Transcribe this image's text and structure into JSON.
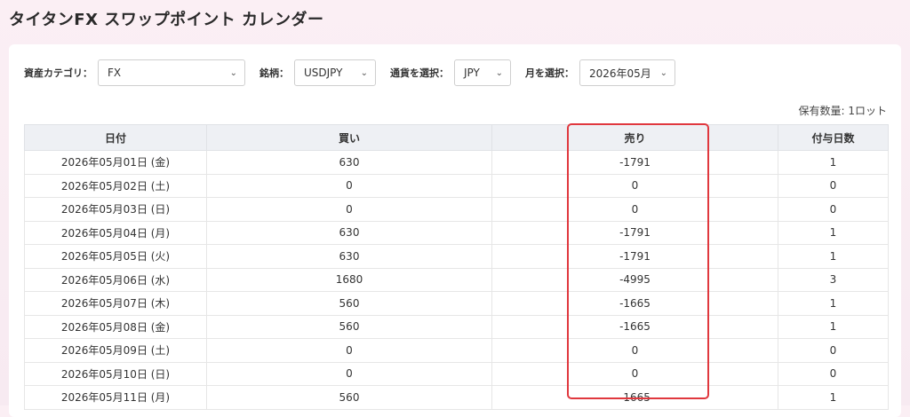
{
  "title": "タイタンFX スワップポイント カレンダー",
  "filters": {
    "asset_label": "資産カテゴリ：",
    "asset_value": "FX",
    "symbol_label": "銘柄：",
    "symbol_value": "USDJPY",
    "currency_label": "通貨を選択：",
    "currency_value": "JPY",
    "month_label": "月を選択：",
    "month_value": "2026年05月"
  },
  "holdings": "保有数量: 1ロット",
  "table": {
    "headers": [
      "日付",
      "買い",
      "売り",
      "付与日数"
    ],
    "rows": [
      [
        "2026年05月01日 (金)",
        "630",
        "-1791",
        "1"
      ],
      [
        "2026年05月02日 (土)",
        "0",
        "0",
        "0"
      ],
      [
        "2026年05月03日 (日)",
        "0",
        "0",
        "0"
      ],
      [
        "2026年05月04日 (月)",
        "630",
        "-1791",
        "1"
      ],
      [
        "2026年05月05日 (火)",
        "630",
        "-1791",
        "1"
      ],
      [
        "2026年05月06日 (水)",
        "1680",
        "-4995",
        "3"
      ],
      [
        "2026年05月07日 (木)",
        "560",
        "-1665",
        "1"
      ],
      [
        "2026年05月08日 (金)",
        "560",
        "-1665",
        "1"
      ],
      [
        "2026年05月09日 (土)",
        "0",
        "0",
        "0"
      ],
      [
        "2026年05月10日 (日)",
        "0",
        "0",
        "0"
      ],
      [
        "2026年05月11日 (月)",
        "560",
        "-1665",
        "1"
      ]
    ]
  },
  "colors": {
    "highlight": "#e0383e",
    "header_bg": "#eef0f4"
  },
  "icons": {
    "dropdown": "chevron-down-icon"
  }
}
